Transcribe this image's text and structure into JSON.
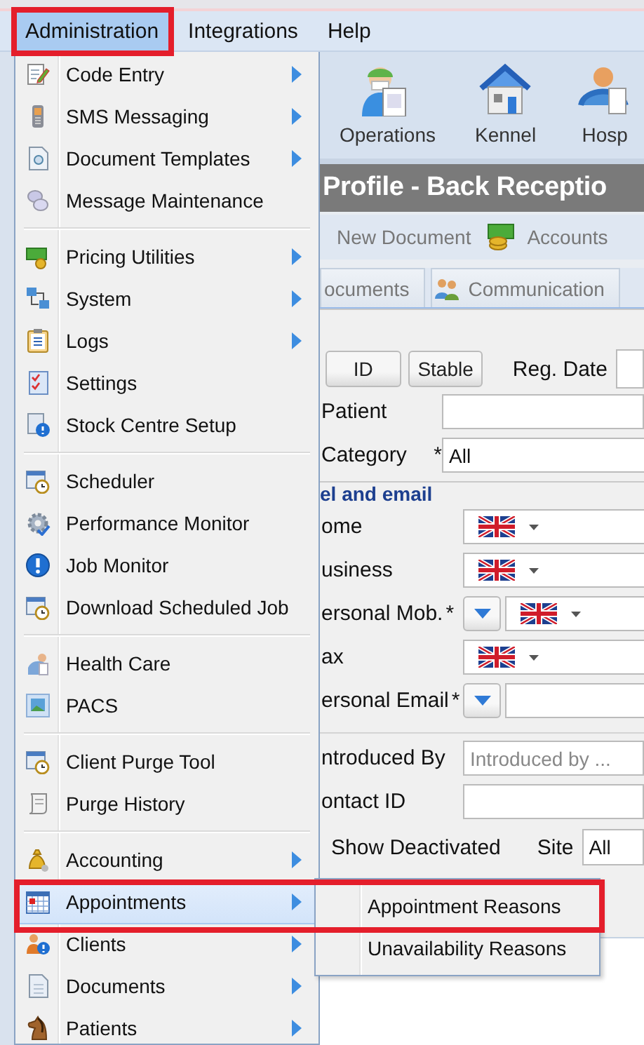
{
  "menubar": {
    "items": [
      {
        "label": "Administration",
        "selected": true,
        "highlighted": true
      },
      {
        "label": "Integrations",
        "selected": false,
        "highlighted": false
      },
      {
        "label": "Help",
        "selected": false,
        "highlighted": false
      }
    ]
  },
  "menu": {
    "sections": [
      [
        {
          "label": "Code Entry",
          "submenu": true,
          "selected": false
        },
        {
          "label": "SMS Messaging",
          "submenu": true,
          "selected": false
        },
        {
          "label": "Document Templates",
          "submenu": true,
          "selected": false
        },
        {
          "label": "Message Maintenance",
          "submenu": false,
          "selected": false
        }
      ],
      [
        {
          "label": "Pricing Utilities",
          "submenu": true,
          "selected": false
        },
        {
          "label": "System",
          "submenu": true,
          "selected": false
        },
        {
          "label": "Logs",
          "submenu": true,
          "selected": false
        },
        {
          "label": "Settings",
          "submenu": false,
          "selected": false
        },
        {
          "label": "Stock Centre Setup",
          "submenu": false,
          "selected": false
        }
      ],
      [
        {
          "label": "Scheduler",
          "submenu": false,
          "selected": false
        },
        {
          "label": "Performance Monitor",
          "submenu": false,
          "selected": false
        },
        {
          "label": "Job Monitor",
          "submenu": false,
          "selected": false
        },
        {
          "label": "Download Scheduled Job",
          "submenu": false,
          "selected": false
        }
      ],
      [
        {
          "label": "Health Care",
          "submenu": false,
          "selected": false
        },
        {
          "label": "PACS",
          "submenu": false,
          "selected": false
        }
      ],
      [
        {
          "label": "Client Purge Tool",
          "submenu": false,
          "selected": false
        },
        {
          "label": "Purge History",
          "submenu": false,
          "selected": false
        }
      ],
      [
        {
          "label": "Accounting",
          "submenu": true,
          "selected": false
        },
        {
          "label": "Appointments",
          "submenu": true,
          "selected": true
        },
        {
          "label": "Clients",
          "submenu": true,
          "selected": false
        },
        {
          "label": "Documents",
          "submenu": true,
          "selected": false
        },
        {
          "label": "Patients",
          "submenu": true,
          "selected": false
        }
      ]
    ]
  },
  "submenu": {
    "items": [
      {
        "label": "Appointment Reasons",
        "highlighted": true
      },
      {
        "label": "Unavailability Reasons",
        "highlighted": false
      }
    ]
  },
  "app": {
    "toolbar": [
      {
        "label": "Operations"
      },
      {
        "label": "Kennel"
      },
      {
        "label": "Hosp"
      }
    ],
    "title": "Profile - Back Receptio",
    "actions": [
      {
        "label": "New Document"
      },
      {
        "label": "Accounts"
      }
    ],
    "tabs": [
      {
        "label": "ocuments",
        "selected": false
      },
      {
        "label": "Communication",
        "selected": false
      }
    ],
    "search_buttons": [
      {
        "label": "ID"
      },
      {
        "label": "Stable"
      }
    ],
    "reg_date_label": "Reg. Date",
    "fields": [
      {
        "kind": "text",
        "label": "Patient"
      },
      {
        "kind": "select",
        "label": "Category",
        "required_mark": "*",
        "value": "All"
      }
    ],
    "contact_section": {
      "legend": "el and email",
      "fields": [
        {
          "kind": "phone",
          "label": "ome"
        },
        {
          "kind": "phone",
          "label": "usiness"
        },
        {
          "kind": "phone",
          "label": "ersonal Mob.",
          "required_mark": "*",
          "dropdown": true
        },
        {
          "kind": "phone",
          "label": "ax"
        },
        {
          "kind": "email",
          "label": "ersonal Email",
          "required_mark": "*",
          "dropdown": true
        }
      ]
    },
    "more_fields": [
      {
        "kind": "text",
        "label": "ntroduced By",
        "placeholder": "Introduced by ..."
      },
      {
        "kind": "text",
        "label": "ontact ID"
      }
    ],
    "show_deactivated_label": "Show Deactivated",
    "site": {
      "label": "Site",
      "value": "All"
    }
  }
}
